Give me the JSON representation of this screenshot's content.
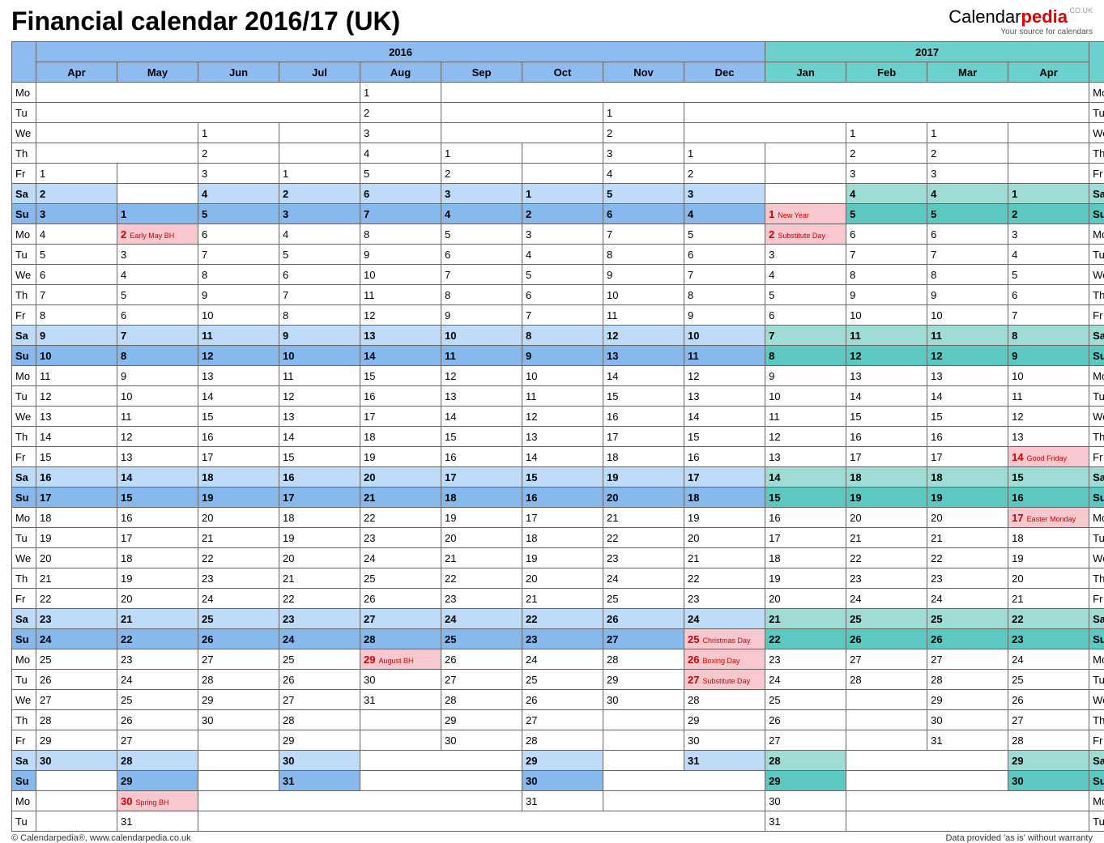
{
  "title": "Financial calendar 2016/17 (UK)",
  "logo": {
    "name": "Calendar",
    "brand": "pedia",
    "tld": ".CO.UK",
    "tagline": "Your source for calendars"
  },
  "footer": {
    "copyright": "© Calendarpedia®, www.calendarpedia.co.uk",
    "disclaimer": "Data provided 'as is' without warranty"
  },
  "years": {
    "y1": "2016",
    "y2": "2017"
  },
  "months": [
    "Apr",
    "May",
    "Jun",
    "Jul",
    "Aug",
    "Sep",
    "Oct",
    "Nov",
    "Dec",
    "Jan",
    "Feb",
    "Mar",
    "Apr"
  ],
  "dow": [
    "Mo",
    "Tu",
    "We",
    "Th",
    "Fr",
    "Sa",
    "Su",
    "Mo",
    "Tu",
    "We",
    "Th",
    "Fr",
    "Sa",
    "Su",
    "Mo",
    "Tu",
    "We",
    "Th",
    "Fr",
    "Sa",
    "Su",
    "Mo",
    "Tu",
    "We",
    "Th",
    "Fr",
    "Sa",
    "Su",
    "Mo",
    "Tu",
    "We",
    "Th",
    "Fr",
    "Sa",
    "Su",
    "Mo",
    "Tu"
  ],
  "firstDowIndex": [
    4,
    6,
    2,
    4,
    0,
    3,
    5,
    1,
    3,
    6,
    2,
    2,
    5
  ],
  "daysInMonth": [
    30,
    31,
    30,
    31,
    31,
    30,
    31,
    30,
    31,
    31,
    28,
    31,
    30
  ],
  "holidays": {
    "1": {
      "2": "Early May BH",
      "30": "Spring BH"
    },
    "4": {
      "29": "August BH"
    },
    "8": {
      "25": "Christmas Day",
      "26": "Boxing Day",
      "27": "Substitute Day"
    },
    "9": {
      "1": "New Year",
      "2": "Substitute Day"
    },
    "12": {
      "14": "Good Friday",
      "17": "Easter Monday"
    }
  },
  "weeks": 37
}
